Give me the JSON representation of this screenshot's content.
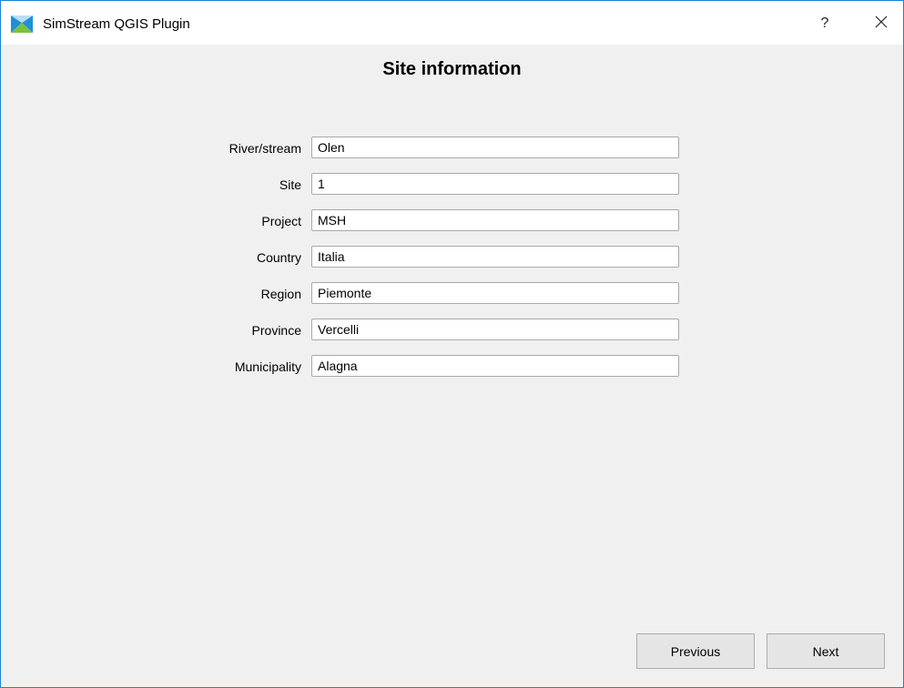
{
  "window": {
    "title": "SimStream QGIS Plugin",
    "help_label": "?",
    "accent_color": "#1883d7"
  },
  "page": {
    "title": "Site information"
  },
  "form": {
    "fields": [
      {
        "label": "River/stream",
        "value": "Olen"
      },
      {
        "label": "Site",
        "value": "1"
      },
      {
        "label": "Project",
        "value": "MSH"
      },
      {
        "label": "Country",
        "value": "Italia"
      },
      {
        "label": "Region",
        "value": "Piemonte"
      },
      {
        "label": "Province",
        "value": "Vercelli"
      },
      {
        "label": "Municipality",
        "value": "Alagna"
      }
    ]
  },
  "buttons": {
    "previous_label": "Previous",
    "next_label": "Next"
  },
  "icons": {
    "app": "app-logo-icon",
    "close": "close-icon"
  }
}
